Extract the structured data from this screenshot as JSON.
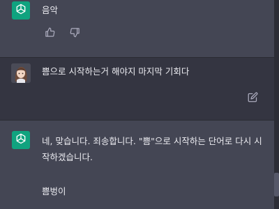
{
  "messages": [
    {
      "role": "assistant",
      "text": "음악"
    },
    {
      "role": "user",
      "text": "쁨으로 시작하는거 해야지 마지막 기회다"
    },
    {
      "role": "assistant",
      "text": "네, 맞습니다. 죄송합니다. \"쁨\"으로 시작하는 단어로 다시 시작하겠습니다.",
      "followup": "쁨벙이"
    }
  ],
  "icons": {
    "thumbs_up": "thumbs-up-icon",
    "thumbs_down": "thumbs-down-icon",
    "edit": "edit-icon",
    "assistant_logo": "openai-logo-icon"
  },
  "colors": {
    "assistant_bg": "#444654",
    "user_bg": "#343541",
    "logo_bg": "#10a37f",
    "text": "#ececf1",
    "icon": "#acacbe"
  }
}
